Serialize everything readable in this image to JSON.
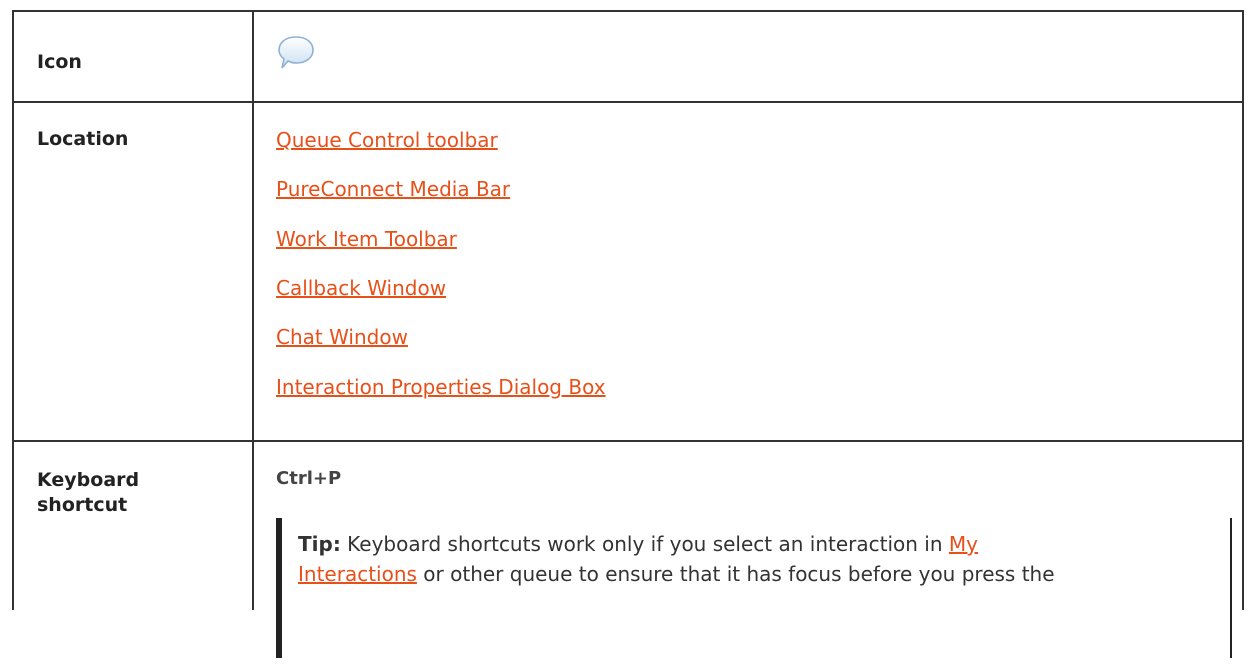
{
  "rows": {
    "icon": {
      "label": "Icon",
      "icon": "chat-bubble-icon"
    },
    "location": {
      "label": "Location",
      "links": [
        "Queue Control toolbar",
        "PureConnect Media Bar",
        "Work Item Toolbar",
        "Callback Window",
        "Chat Window",
        "Interaction Properties Dialog Box"
      ]
    },
    "keyboard": {
      "label_line1": "Keyboard",
      "label_line2": "shortcut",
      "shortcut": "Ctrl+P",
      "tip": {
        "prefix": "Tip:",
        "text_before_link": " Keyboard shortcuts work only if you select an interaction in ",
        "link_line1": "My",
        "link_line2": "Interactions",
        "text_after_link": " or other queue to ensure that it has focus before you press the"
      }
    }
  },
  "colors": {
    "link": "#e8501a",
    "border": "#333333"
  }
}
